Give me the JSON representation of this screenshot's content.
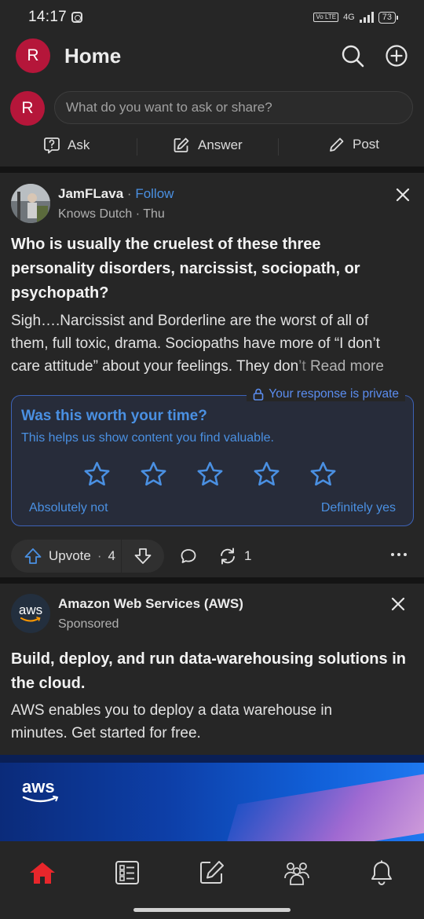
{
  "status_bar": {
    "time": "14:17",
    "network": "4G",
    "volte": "Vo LTE",
    "battery": "73"
  },
  "header": {
    "avatar_letter": "R",
    "title": "Home",
    "icons": [
      "search-icon",
      "add-circle-icon"
    ]
  },
  "composer": {
    "avatar_letter": "R",
    "placeholder": "What do you want to ask or share?",
    "actions": [
      {
        "label": "Ask",
        "icon": "question-icon"
      },
      {
        "label": "Answer",
        "icon": "edit-icon"
      },
      {
        "label": "Post",
        "icon": "pencil-icon"
      }
    ]
  },
  "post": {
    "author": "JamFLava",
    "separator": "·",
    "follow": "Follow",
    "subtitle": "Knows Dutch · Thu",
    "question": "Who is usually the cruelest of these three personality disorders, narcissist, sociopath, or psychopath?",
    "body_line1": "Sigh….Narcissist and Borderline are the worst of all of",
    "body_line2": "them, full toxic, drama. Sociopaths have more of “I don’t",
    "body_line3_visible": "care attitude” about your feelings. They don",
    "body_line3_fade": "’t",
    "read_more": "Read more",
    "rating": {
      "private_label": "Your response is private",
      "title": "Was this worth your time?",
      "subtitle": "This helps us show content you find valuable.",
      "star_count": 5,
      "left_label": "Absolutely not",
      "right_label": "Definitely yes"
    },
    "upvote_label": "Upvote",
    "upvote_count": "4",
    "share_count": "1"
  },
  "ad": {
    "logo_text": "aws",
    "advertiser": "Amazon Web Services (AWS)",
    "label": "Sponsored",
    "headline": "Build, deploy, and run data-warehousing solutions in the cloud.",
    "body": "AWS enables you to deploy a data warehouse in minutes. Get started for free.",
    "banner_logo": "aws"
  },
  "bottom_nav": {
    "items": [
      "home-icon",
      "following-icon",
      "answer-icon",
      "spaces-icon",
      "notifications-icon"
    ],
    "active_color": "#e8262b"
  }
}
